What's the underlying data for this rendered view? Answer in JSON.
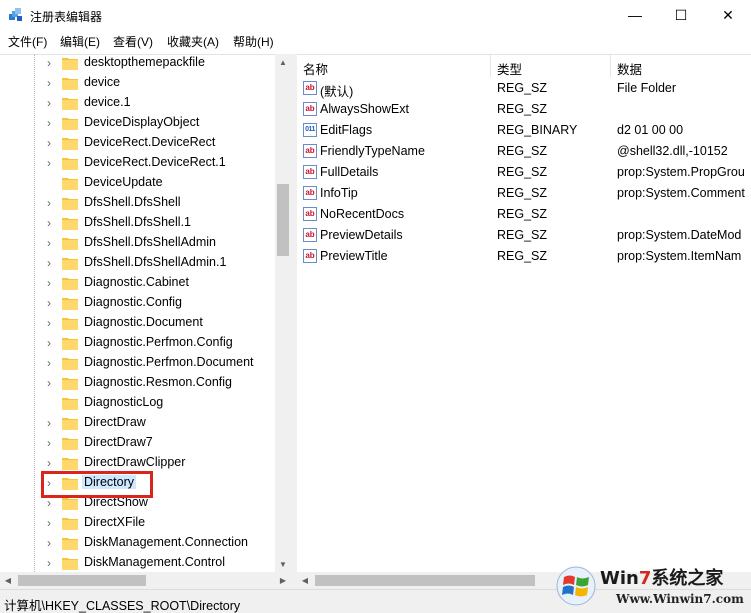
{
  "window": {
    "title": "注册表编辑器",
    "minimize_glyph": "—",
    "maximize_glyph": "☐",
    "close_glyph": "✕"
  },
  "menu": [
    "文件(F)",
    "编辑(E)",
    "查看(V)",
    "收藏夹(A)",
    "帮助(H)"
  ],
  "tree": {
    "items": [
      {
        "label": "desktopthemepackfile",
        "expandable": true
      },
      {
        "label": "device",
        "expandable": true
      },
      {
        "label": "device.1",
        "expandable": true
      },
      {
        "label": "DeviceDisplayObject",
        "expandable": true
      },
      {
        "label": "DeviceRect.DeviceRect",
        "expandable": true
      },
      {
        "label": "DeviceRect.DeviceRect.1",
        "expandable": true
      },
      {
        "label": "DeviceUpdate",
        "expandable": false
      },
      {
        "label": "DfsShell.DfsShell",
        "expandable": true
      },
      {
        "label": "DfsShell.DfsShell.1",
        "expandable": true
      },
      {
        "label": "DfsShell.DfsShellAdmin",
        "expandable": true
      },
      {
        "label": "DfsShell.DfsShellAdmin.1",
        "expandable": true
      },
      {
        "label": "Diagnostic.Cabinet",
        "expandable": true
      },
      {
        "label": "Diagnostic.Config",
        "expandable": true
      },
      {
        "label": "Diagnostic.Document",
        "expandable": true
      },
      {
        "label": "Diagnostic.Perfmon.Config",
        "expandable": true
      },
      {
        "label": "Diagnostic.Perfmon.Document",
        "expandable": true
      },
      {
        "label": "Diagnostic.Resmon.Config",
        "expandable": true
      },
      {
        "label": "DiagnosticLog",
        "expandable": false
      },
      {
        "label": "DirectDraw",
        "expandable": true
      },
      {
        "label": "DirectDraw7",
        "expandable": true
      },
      {
        "label": "DirectDrawClipper",
        "expandable": true
      },
      {
        "label": "Directory",
        "expandable": true,
        "selected": true
      },
      {
        "label": "DirectShow",
        "expandable": true
      },
      {
        "label": "DirectXFile",
        "expandable": true
      },
      {
        "label": "DiskManagement.Connection",
        "expandable": true
      },
      {
        "label": "DiskManagement.Control",
        "expandable": true
      }
    ]
  },
  "values": {
    "columns": [
      "名称",
      "类型",
      "数据"
    ],
    "rows": [
      {
        "name": "(默认)",
        "type": "REG_SZ",
        "data": "File Folder",
        "icon": "ab"
      },
      {
        "name": "AlwaysShowExt",
        "type": "REG_SZ",
        "data": "",
        "icon": "ab"
      },
      {
        "name": "EditFlags",
        "type": "REG_BINARY",
        "data": "d2 01 00 00",
        "icon": "bin"
      },
      {
        "name": "FriendlyTypeName",
        "type": "REG_SZ",
        "data": "@shell32.dll,-10152",
        "icon": "ab"
      },
      {
        "name": "FullDetails",
        "type": "REG_SZ",
        "data": "prop:System.PropGrou",
        "icon": "ab"
      },
      {
        "name": "InfoTip",
        "type": "REG_SZ",
        "data": "prop:System.Comment",
        "icon": "ab"
      },
      {
        "name": "NoRecentDocs",
        "type": "REG_SZ",
        "data": "",
        "icon": "ab"
      },
      {
        "name": "PreviewDetails",
        "type": "REG_SZ",
        "data": "prop:System.DateMod",
        "icon": "ab"
      },
      {
        "name": "PreviewTitle",
        "type": "REG_SZ",
        "data": "prop:System.ItemNam",
        "icon": "ab"
      }
    ]
  },
  "icons": {
    "ab_text": "ab",
    "bin_text": "011"
  },
  "status": {
    "path": "计算机\\HKEY_CLASSES_ROOT\\Directory"
  },
  "watermark": {
    "title_prefix": "Win",
    "title_seven": "7",
    "title_suffix": "系统之家",
    "url": "Www.Winwin7.com"
  },
  "colors": {
    "highlight_box": "#d9261c",
    "selection": "#cde8ff",
    "folder": "#f5c342"
  }
}
